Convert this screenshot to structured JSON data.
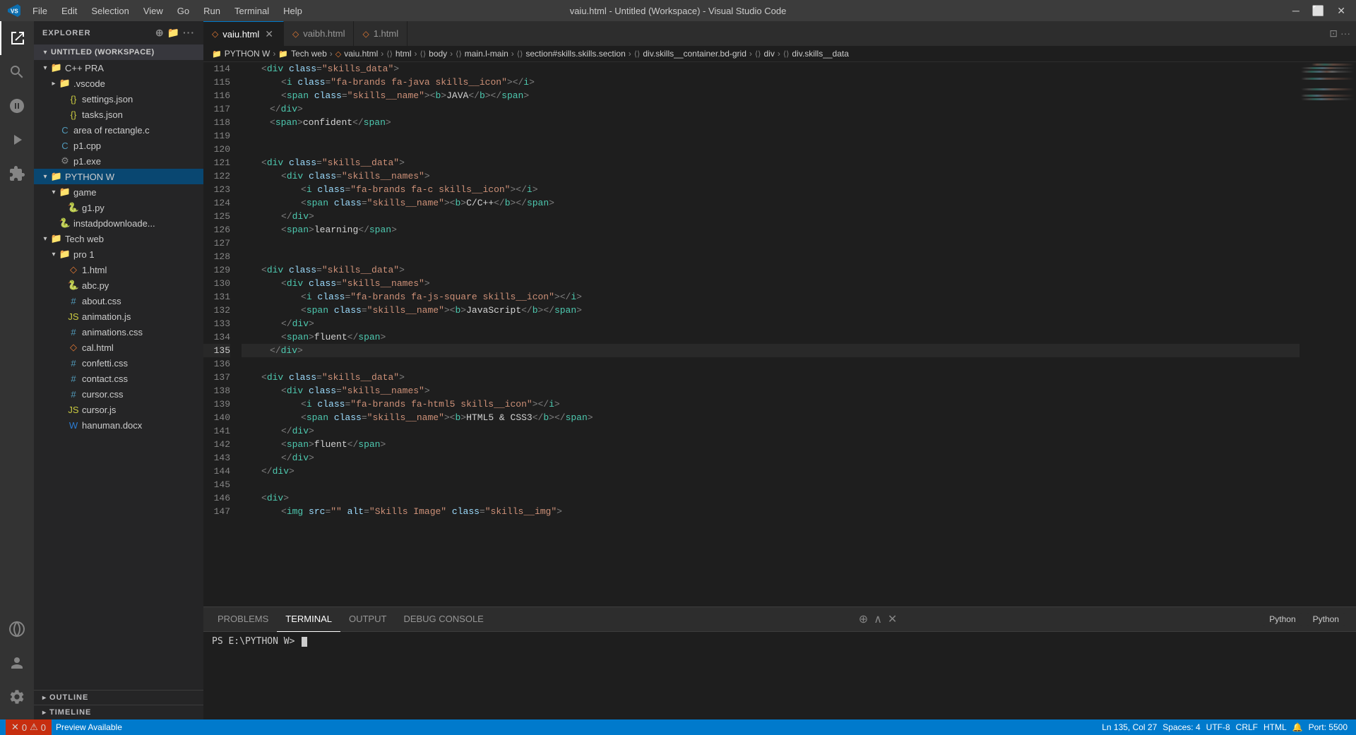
{
  "titleBar": {
    "logo": "VS",
    "menu": [
      "File",
      "Edit",
      "Selection",
      "View",
      "Go",
      "Run",
      "Terminal",
      "Help"
    ],
    "title": "vaiu.html - Untitled (Workspace) - Visual Studio Code",
    "controls": [
      "⬜",
      "❐",
      "✕"
    ]
  },
  "tabs": [
    {
      "id": "vaiu",
      "label": "vaiu.html",
      "icon": "◇",
      "active": true
    },
    {
      "id": "vaibh",
      "label": "vaibh.html",
      "icon": "◇",
      "active": false
    },
    {
      "id": "1html",
      "label": "1.html",
      "icon": "◇",
      "active": false
    }
  ],
  "breadcrumb": [
    "PYTHON W",
    "Tech web",
    "vaiu.html",
    "html",
    "body",
    "main.l-main",
    "section#skills.skills.section",
    "div.skills__container.bd-grid",
    "div",
    "div.skills__data"
  ],
  "sidebar": {
    "title": "EXPLORER",
    "workspace": "UNTITLED (WORKSPACE)",
    "tree": [
      {
        "indent": 1,
        "type": "folder",
        "open": true,
        "label": "C++ PRA"
      },
      {
        "indent": 2,
        "type": "folder",
        "open": false,
        "label": ".vscode"
      },
      {
        "indent": 2,
        "type": "json",
        "label": "settings.json"
      },
      {
        "indent": 2,
        "type": "json",
        "label": "tasks.json"
      },
      {
        "indent": 2,
        "type": "c",
        "label": "area of rectangle.c"
      },
      {
        "indent": 2,
        "type": "cpp",
        "label": "p1.cpp"
      },
      {
        "indent": 2,
        "type": "exe",
        "label": "p1.exe"
      },
      {
        "indent": 1,
        "type": "folder",
        "open": true,
        "label": "PYTHON W",
        "active": true
      },
      {
        "indent": 2,
        "type": "folder",
        "open": true,
        "label": "game"
      },
      {
        "indent": 3,
        "type": "py",
        "label": "g1.py"
      },
      {
        "indent": 2,
        "type": "py",
        "label": "instadpdownloade..."
      },
      {
        "indent": 1,
        "type": "folder",
        "open": true,
        "label": "Tech web"
      },
      {
        "indent": 2,
        "type": "folder",
        "open": true,
        "label": "pro 1"
      },
      {
        "indent": 3,
        "type": "html",
        "label": "1.html"
      },
      {
        "indent": 3,
        "type": "py",
        "label": "abc.py"
      },
      {
        "indent": 3,
        "type": "css",
        "label": "about.css"
      },
      {
        "indent": 3,
        "type": "js",
        "label": "animation.js"
      },
      {
        "indent": 3,
        "type": "css",
        "label": "animations.css"
      },
      {
        "indent": 3,
        "type": "html",
        "label": "cal.html"
      },
      {
        "indent": 3,
        "type": "css",
        "label": "confetti.css"
      },
      {
        "indent": 3,
        "type": "css",
        "label": "contact.css"
      },
      {
        "indent": 3,
        "type": "css",
        "label": "cursor.css"
      },
      {
        "indent": 3,
        "type": "js",
        "label": "cursor.js"
      },
      {
        "indent": 3,
        "type": "word",
        "label": "hanuman.docx"
      }
    ],
    "outline": "OUTLINE",
    "timeline": "TIMELINE"
  },
  "editor": {
    "lines": [
      {
        "num": 114,
        "content": "<span class='t-tag'>&lt;</span><span class='t-tagname'>div</span><span class='t-attr'> class</span><span class='t-tag'>=</span><span class='t-string'>\"skills_data\"</span><span class='t-tag'>&gt;</span>"
      },
      {
        "num": 115,
        "content": "    <span class='t-tag'>&lt;</span><span class='t-tagname'>i</span><span class='t-attr'> class</span><span class='t-tag'>=</span><span class='t-string'>\"fa-brands fa-java skills__icon\"</span><span class='t-tag'>&gt;&lt;/</span><span class='t-tagname'>i</span><span class='t-tag'>&gt;</span>"
      },
      {
        "num": 116,
        "content": "    <span class='t-tag'>&lt;</span><span class='t-tagname'>span</span><span class='t-attr'> class</span><span class='t-tag'>=</span><span class='t-string'>\"skills__name\"</span><span class='t-tag'>&gt;&lt;</span><span class='t-tagname'>b</span><span class='t-tag'>&gt;</span><span class='t-text'>JAVA</span><span class='t-tag'>&lt;/</span><span class='t-tagname'>b</span><span class='t-tag'>&gt;&lt;/</span><span class='t-tagname'>span</span><span class='t-tag'>&gt;</span>"
      },
      {
        "num": 117,
        "content": "    <span class='t-tag'>&lt;/</span><span class='t-tagname'>div</span><span class='t-tag'>&gt;</span>"
      },
      {
        "num": 118,
        "content": "    <span class='t-tag'>&lt;</span><span class='t-tagname'>span</span><span class='t-tag'>&gt;</span><span class='t-text'>confident</span><span class='t-tag'>&lt;/</span><span class='t-tagname'>span</span><span class='t-tag'>&gt;</span>"
      },
      {
        "num": 119,
        "content": ""
      },
      {
        "num": 120,
        "content": ""
      },
      {
        "num": 121,
        "content": "<span class='t-tag'>&lt;</span><span class='t-tagname'>div</span><span class='t-attr'> class</span><span class='t-tag'>=</span><span class='t-string'>\"skills__data\"</span><span class='t-tag'>&gt;</span>"
      },
      {
        "num": 122,
        "content": "    <span class='t-tag'>&lt;</span><span class='t-tagname'>div</span><span class='t-attr'> class</span><span class='t-tag'>=</span><span class='t-string'>\"skills__names\"</span><span class='t-tag'>&gt;</span>"
      },
      {
        "num": 123,
        "content": "        <span class='t-tag'>&lt;</span><span class='t-tagname'>i</span><span class='t-attr'> class</span><span class='t-tag'>=</span><span class='t-string'>\"fa-brands fa-c skills__icon\"</span><span class='t-tag'>&gt;&lt;/</span><span class='t-tagname'>i</span><span class='t-tag'>&gt;</span>"
      },
      {
        "num": 124,
        "content": "        <span class='t-tag'>&lt;</span><span class='t-tagname'>span</span><span class='t-attr'> class</span><span class='t-tag'>=</span><span class='t-string'>\"skills__name\"</span><span class='t-tag'>&gt;&lt;</span><span class='t-tagname'>b</span><span class='t-tag'>&gt;</span><span class='t-text'>C/C++</span><span class='t-tag'>&lt;/</span><span class='t-tagname'>b</span><span class='t-tag'>&gt;&lt;/</span><span class='t-tagname'>span</span><span class='t-tag'>&gt;</span>"
      },
      {
        "num": 125,
        "content": "    <span class='t-tag'>&lt;/</span><span class='t-tagname'>div</span><span class='t-tag'>&gt;</span>"
      },
      {
        "num": 126,
        "content": "    <span class='t-tag'>&lt;</span><span class='t-tagname'>span</span><span class='t-tag'>&gt;</span><span class='t-text'>learning</span><span class='t-tag'>&lt;/</span><span class='t-tagname'>span</span><span class='t-tag'>&gt;</span>"
      },
      {
        "num": 127,
        "content": ""
      },
      {
        "num": 128,
        "content": ""
      },
      {
        "num": 129,
        "content": "<span class='t-tag'>&lt;</span><span class='t-tagname'>div</span><span class='t-attr'> class</span><span class='t-tag'>=</span><span class='t-string'>\"skills__data\"</span><span class='t-tag'>&gt;</span>"
      },
      {
        "num": 130,
        "content": "    <span class='t-tag'>&lt;</span><span class='t-tagname'>div</span><span class='t-attr'> class</span><span class='t-tag'>=</span><span class='t-string'>\"skills__names\"</span><span class='t-tag'>&gt;</span>"
      },
      {
        "num": 131,
        "content": "        <span class='t-tag'>&lt;</span><span class='t-tagname'>i</span><span class='t-attr'> class</span><span class='t-tag'>=</span><span class='t-string'>\"fa-brands fa-js-square skills__icon\"</span><span class='t-tag'>&gt;&lt;/</span><span class='t-tagname'>i</span><span class='t-tag'>&gt;</span>"
      },
      {
        "num": 132,
        "content": "        <span class='t-tag'>&lt;</span><span class='t-tagname'>span</span><span class='t-attr'> class</span><span class='t-tag'>=</span><span class='t-string'>\"skills__name\"</span><span class='t-tag'>&gt;&lt;</span><span class='t-tagname'>b</span><span class='t-tag'>&gt;</span><span class='t-text'>JavaScript</span><span class='t-tag'>&lt;/</span><span class='t-tagname'>b</span><span class='t-tag'>&gt;&lt;/</span><span class='t-tagname'>span</span><span class='t-tag'>&gt;</span>"
      },
      {
        "num": 133,
        "content": "    <span class='t-tag'>&lt;/</span><span class='t-tagname'>div</span><span class='t-tag'>&gt;</span>"
      },
      {
        "num": 134,
        "content": "    <span class='t-tag'>&lt;</span><span class='t-tagname'>span</span><span class='t-tag'>&gt;</span><span class='t-text'>fluent</span><span class='t-tag'>&lt;/</span><span class='t-tagname'>span</span><span class='t-tag'>&gt;</span>"
      },
      {
        "num": 135,
        "content": "    <span class='t-tag'>&lt;/</span><span class='t-tagname'>div</span><span class='t-tag'>&gt;</span>",
        "cursor": true
      },
      {
        "num": 136,
        "content": ""
      },
      {
        "num": 137,
        "content": "<span class='t-tag'>&lt;</span><span class='t-tagname'>div</span><span class='t-attr'> class</span><span class='t-tag'>=</span><span class='t-string'>\"skills__data\"</span><span class='t-tag'>&gt;</span>"
      },
      {
        "num": 138,
        "content": "    <span class='t-tag'>&lt;</span><span class='t-tagname'>div</span><span class='t-attr'> class</span><span class='t-tag'>=</span><span class='t-string'>\"skills__names\"</span><span class='t-tag'>&gt;</span>"
      },
      {
        "num": 139,
        "content": "        <span class='t-tag'>&lt;</span><span class='t-tagname'>i</span><span class='t-attr'> class</span><span class='t-tag'>=</span><span class='t-string'>\"fa-brands fa-html5 skills__icon\"</span><span class='t-tag'>&gt;&lt;/</span><span class='t-tagname'>i</span><span class='t-tag'>&gt;</span>"
      },
      {
        "num": 140,
        "content": "        <span class='t-tag'>&lt;</span><span class='t-tagname'>span</span><span class='t-attr'> class</span><span class='t-tag'>=</span><span class='t-string'>\"skills__name\"</span><span class='t-tag'>&gt;&lt;</span><span class='t-tagname'>b</span><span class='t-tag'>&gt;</span><span class='t-text'>HTML5 &amp; CSS3</span><span class='t-tag'>&lt;/</span><span class='t-tagname'>b</span><span class='t-tag'>&gt;&lt;/</span><span class='t-tagname'>span</span><span class='t-tag'>&gt;</span>"
      },
      {
        "num": 141,
        "content": "    <span class='t-tag'>&lt;/</span><span class='t-tagname'>div</span><span class='t-tag'>&gt;</span>"
      },
      {
        "num": 142,
        "content": "    <span class='t-tag'>&lt;</span><span class='t-tagname'>span</span><span class='t-tag'>&gt;</span><span class='t-text'>fluent</span><span class='t-tag'>&lt;/</span><span class='t-tagname'>span</span><span class='t-tag'>&gt;</span>"
      },
      {
        "num": 143,
        "content": "    <span class='t-tag'>&lt;/</span><span class='t-tagname'>div</span><span class='t-tag'>&gt;</span>"
      },
      {
        "num": 144,
        "content": "<span class='t-tag'>&lt;/</span><span class='t-tagname'>div</span><span class='t-tag'>&gt;</span>"
      },
      {
        "num": 145,
        "content": ""
      },
      {
        "num": 146,
        "content": "<span class='t-tag'>&lt;</span><span class='t-tagname'>div</span><span class='t-tag'>&gt;</span>"
      },
      {
        "num": 147,
        "content": "    <span class='t-tag'>&lt;</span><span class='t-tagname'>img</span><span class='t-attr'> src</span><span class='t-tag'>=</span><span class='t-string'>\"\"</span><span class='t-attr'> alt</span><span class='t-tag'>=</span><span class='t-string'>\"Skills Image\"</span><span class='t-attr'> class</span><span class='t-tag'>=</span><span class='t-string'>\"skills__img\"</span><span class='t-tag'>&gt;</span>"
      }
    ]
  },
  "panel": {
    "tabs": [
      "PROBLEMS",
      "TERMINAL",
      "OUTPUT",
      "DEBUG CONSOLE"
    ],
    "activeTab": "TERMINAL",
    "terminalContent": "PS E:\\PYTHON W>",
    "pythonLabels": [
      "Python",
      "Python"
    ]
  },
  "statusBar": {
    "errors": "0",
    "warnings": "0",
    "preview": "Preview Available",
    "branch": "",
    "line": "Ln 135, Col 27",
    "spaces": "Spaces: 4",
    "encoding": "UTF-8",
    "lineEnding": "CRLF",
    "language": "HTML",
    "bell": "",
    "port": "Port: 5500"
  }
}
